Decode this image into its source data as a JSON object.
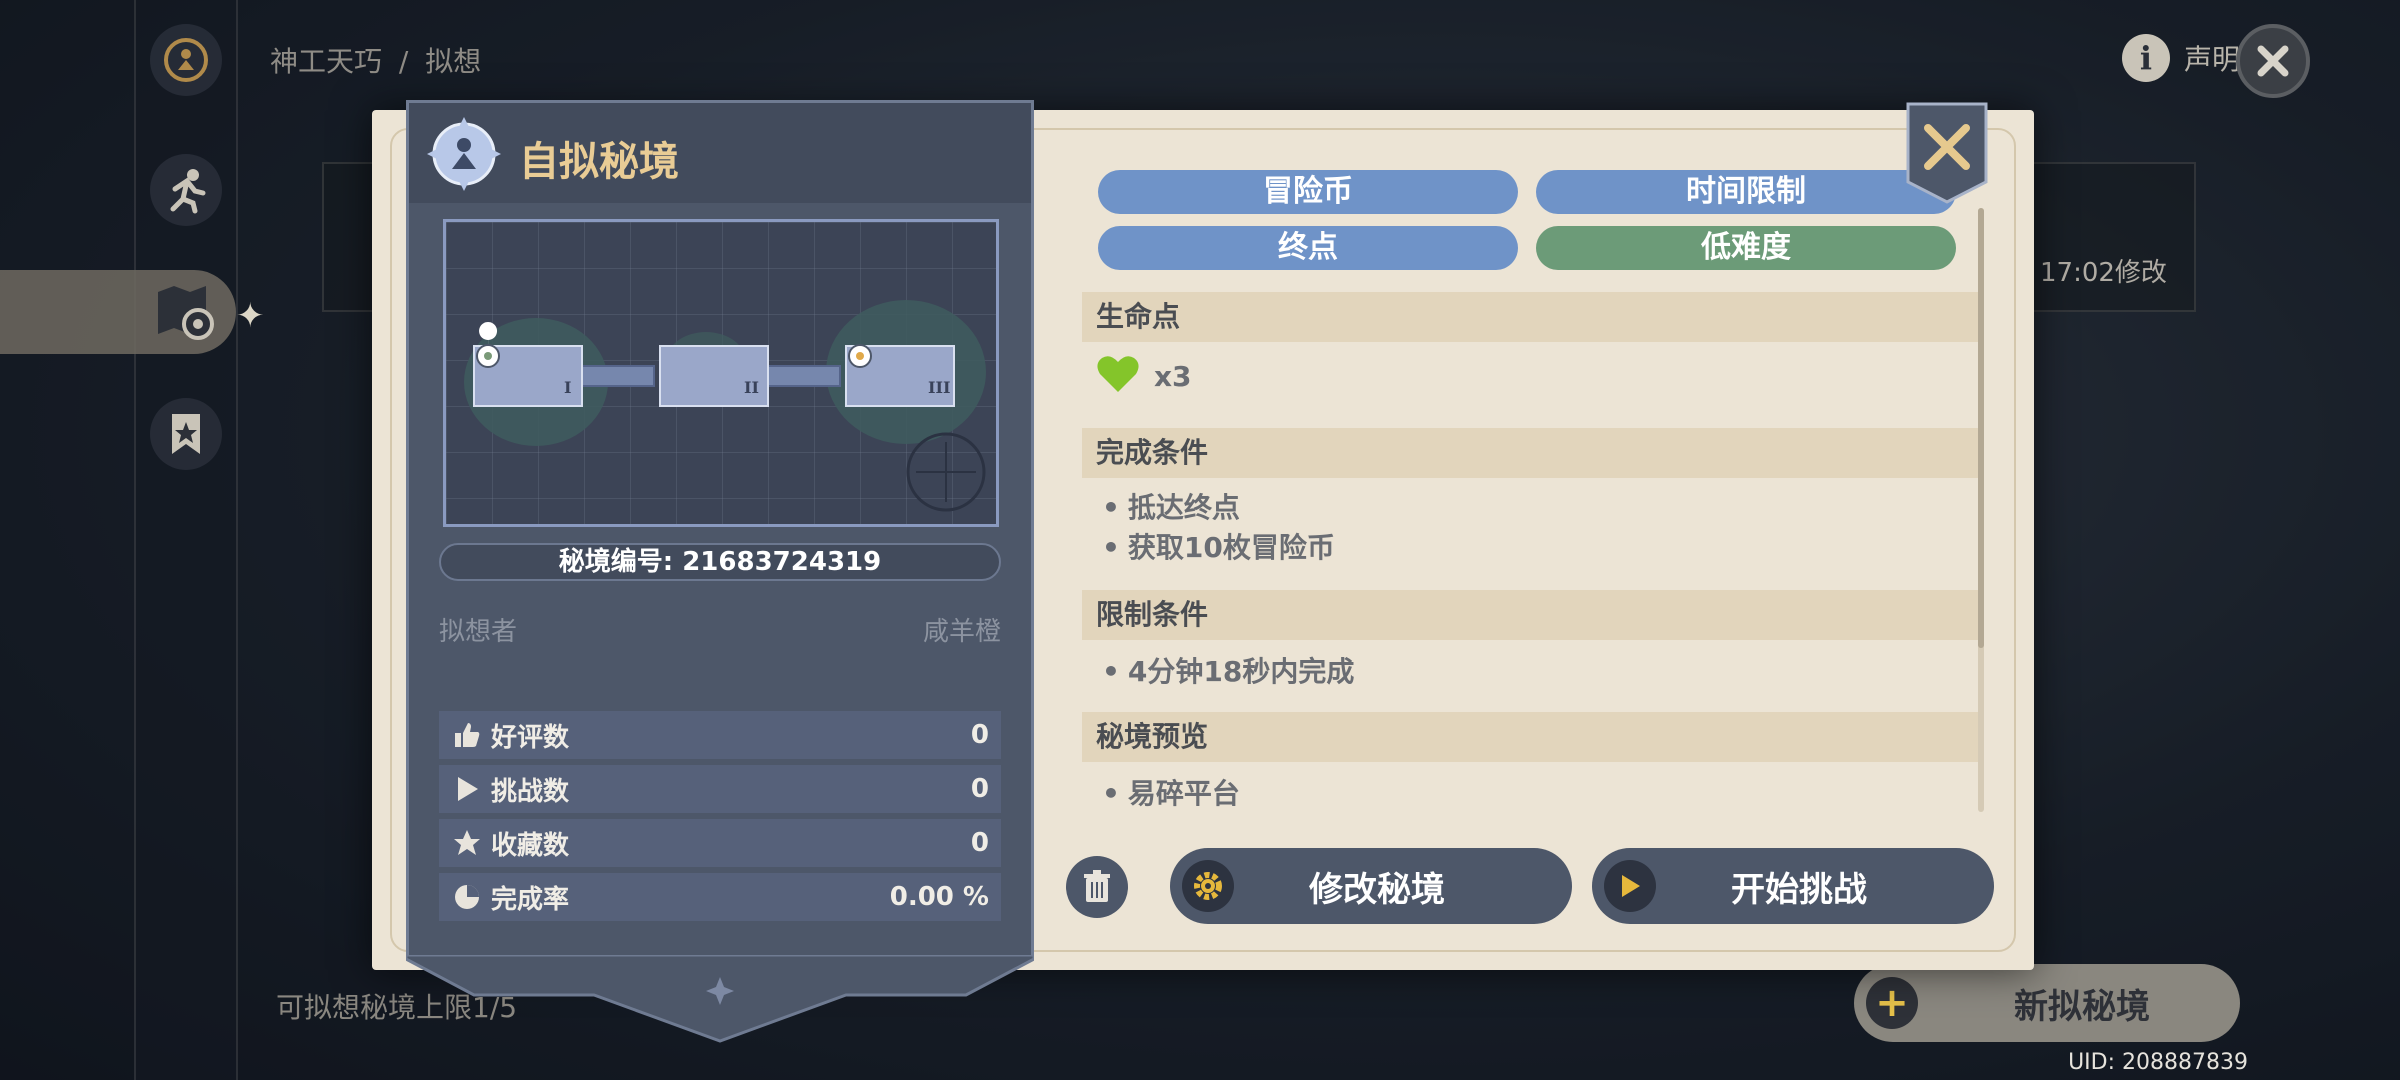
{
  "breadcrumb": {
    "parent": "神工天巧",
    "sep": "/",
    "current": "拟想"
  },
  "top": {
    "statement_label": "声明",
    "info_glyph": "i"
  },
  "background": {
    "card_time": "17:02修改",
    "limit_text": "可拟想秘境上限1/5",
    "new_button_label": "新拟秘境",
    "uid": "UID: 208887839"
  },
  "panel": {
    "title": "自拟秘境",
    "domain_id_text": "秘境编号: 21683724319",
    "creator_label": "拟想者",
    "creator_name": "咸羊橙",
    "stats": [
      {
        "label": "好评数",
        "value": "0",
        "icon": "thumbs-up-icon"
      },
      {
        "label": "挑战数",
        "value": "0",
        "icon": "play-icon"
      },
      {
        "label": "收藏数",
        "value": "0",
        "icon": "star-icon"
      },
      {
        "label": "完成率",
        "value": "0.00 %",
        "icon": "pie-icon"
      }
    ],
    "map_room_labels": [
      "I",
      "II",
      "III"
    ]
  },
  "tags": [
    {
      "label": "冒险币",
      "color": "#6f93c8"
    },
    {
      "label": "时间限制",
      "color": "#6f93c8"
    },
    {
      "label": "终点",
      "color": "#6f93c8"
    },
    {
      "label": "低难度",
      "color": "#6c9b78"
    }
  ],
  "sections": {
    "hp": {
      "title": "生命点",
      "value": "x3",
      "icon": "heart-icon",
      "icon_color": "#84c52a"
    },
    "completion": {
      "title": "完成条件",
      "items": [
        "抵达终点",
        "获取10枚冒险币"
      ]
    },
    "limits": {
      "title": "限制条件",
      "items": [
        "4分钟18秒内完成"
      ]
    },
    "preview": {
      "title": "秘境预览",
      "items": [
        "易碎平台"
      ]
    }
  },
  "buttons": {
    "edit_label": "修改秘境",
    "start_label": "开始挑战"
  },
  "colors": {
    "accent_gold": "#e9cc95",
    "panel_blue": "#4d5769",
    "dialog_bg": "#ece4d5"
  }
}
